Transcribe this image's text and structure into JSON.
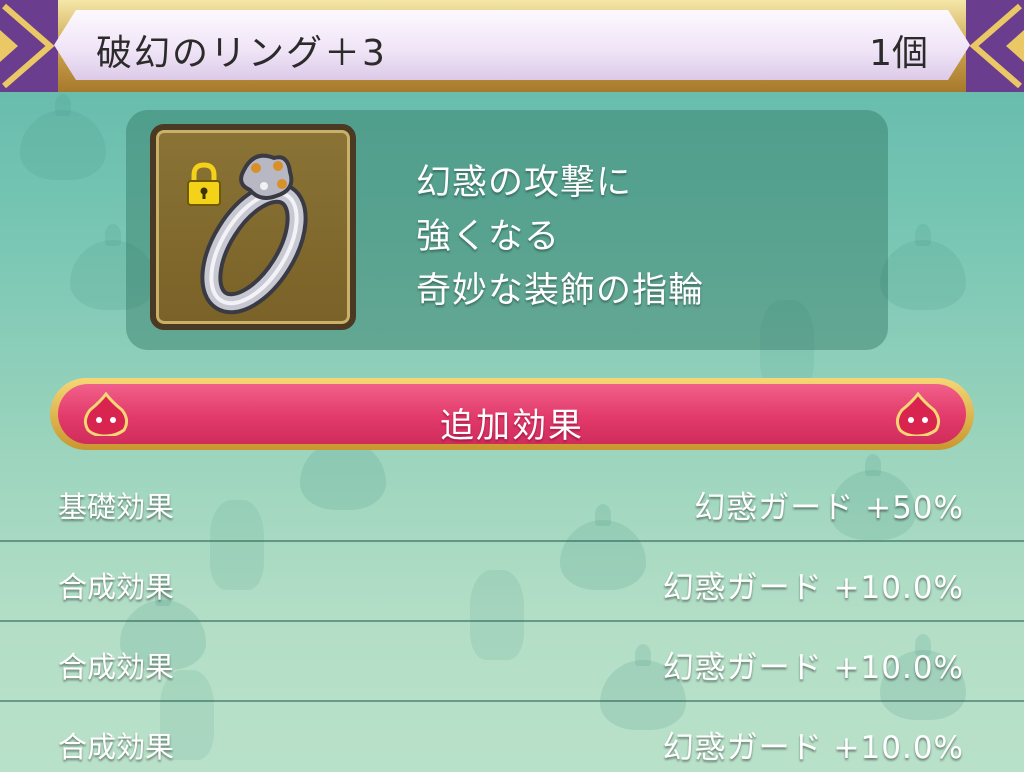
{
  "title_bar": {
    "item_name": "破幻のリング＋3",
    "item_count": "1個"
  },
  "item": {
    "icon": "ring-icon",
    "locked": true,
    "lock_icon": "lock-icon",
    "description_lines": [
      "幻惑の攻撃に",
      "強くなる",
      "奇妙な装飾の指輪"
    ]
  },
  "section": {
    "header_label": "追加効果"
  },
  "effects": [
    {
      "label": "基礎効果",
      "value": "幻惑ガード +50%"
    },
    {
      "label": "合成効果",
      "value": "幻惑ガード +10.0%"
    },
    {
      "label": "合成効果",
      "value": "幻惑ガード +10.0%"
    },
    {
      "label": "合成効果",
      "value": "幻惑ガード +10.0%"
    }
  ],
  "colors": {
    "title_frame": "#c9a24a",
    "corner_purple": "#6b3d8f",
    "header_pink": "#e23a6b",
    "background_teal": "#78c6b4"
  }
}
